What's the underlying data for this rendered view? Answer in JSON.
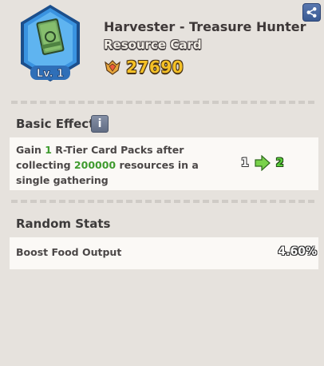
{
  "card": {
    "title": "Harvester - Treasure Hunter",
    "type": "Resource Card",
    "level_label": "Lv. 1",
    "price": "27690",
    "icon": "card-pack-icon",
    "frame_color": "#2f86d8"
  },
  "share": {
    "icon": "share-icon"
  },
  "basic_effect": {
    "title": "Basic Effect",
    "info_icon": "info-icon",
    "text_part1": "Gain ",
    "count": "1",
    "text_part2": " R-Tier Card Packs after collecting ",
    "threshold": "200000",
    "text_part3": " resources in a single gathering",
    "level_from": "1",
    "level_to": "2",
    "highlight_color": "#3f9b2f"
  },
  "random_stats": {
    "title": "Random Stats",
    "stats": [
      {
        "name": "Boost Food Output",
        "value": "4.60%"
      }
    ]
  }
}
